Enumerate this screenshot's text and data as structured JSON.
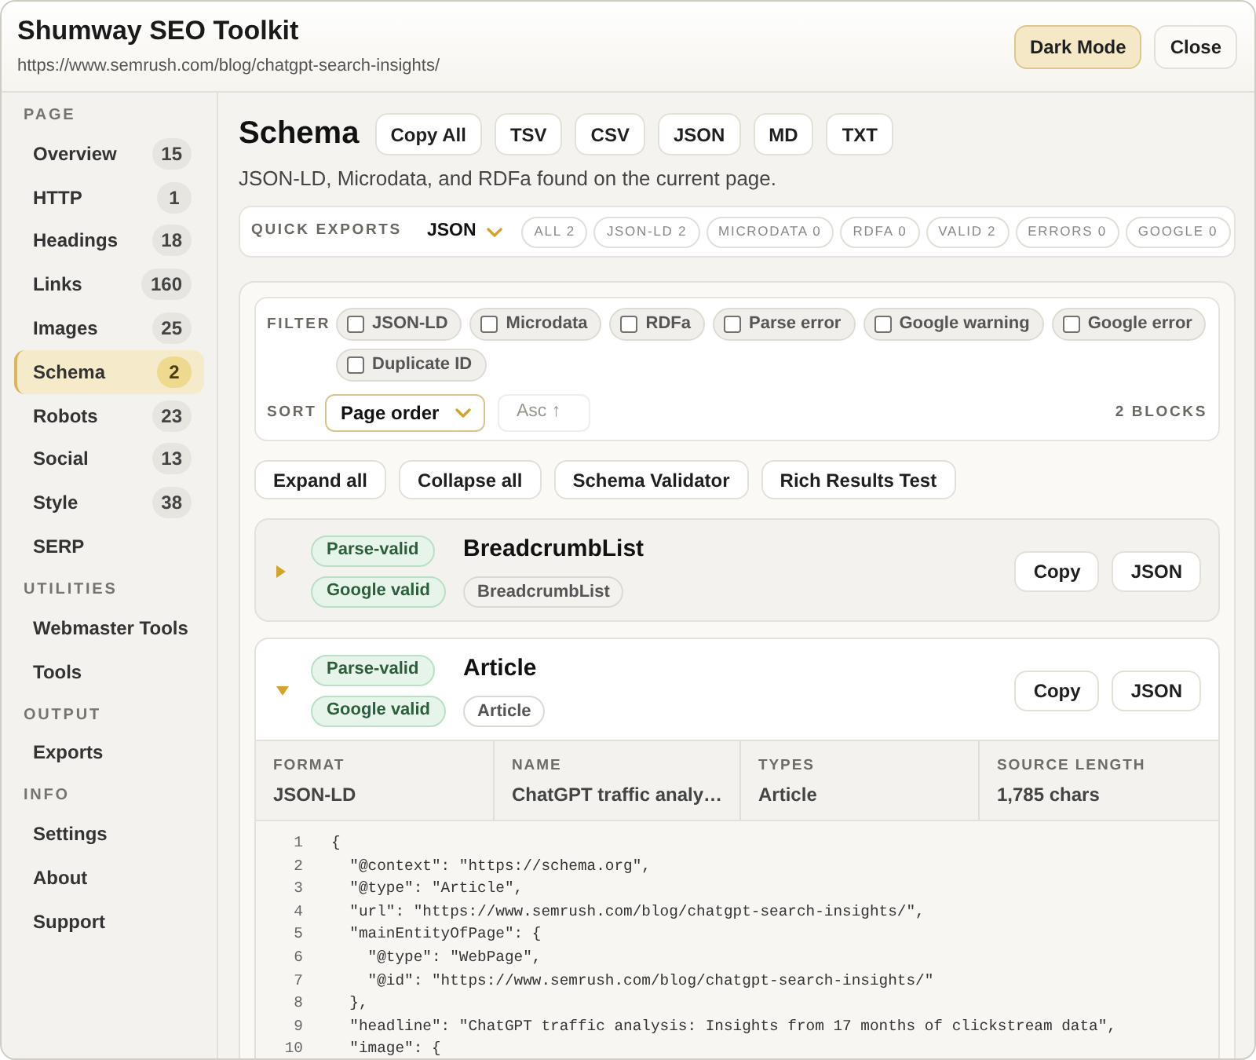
{
  "window": {
    "title": "Shumway SEO Toolkit",
    "url": "https://www.semrush.com/blog/chatgpt-search-insights/"
  },
  "header_buttons": [
    {
      "label": "Dark Mode",
      "kind": "accent"
    },
    {
      "label": "Close",
      "kind": "plain"
    }
  ],
  "sidebar": {
    "sections": [
      {
        "title": "PAGE",
        "items": [
          {
            "label": "Overview",
            "count": "15",
            "selected": false
          },
          {
            "label": "HTTP",
            "count": "1",
            "selected": false
          },
          {
            "label": "Headings",
            "count": "18",
            "selected": false
          },
          {
            "label": "Links",
            "count": "160",
            "selected": false
          },
          {
            "label": "Images",
            "count": "25",
            "selected": false
          },
          {
            "label": "Schema",
            "count": "2",
            "selected": true
          },
          {
            "label": "Robots",
            "count": "23",
            "selected": false
          },
          {
            "label": "Social",
            "count": "13",
            "selected": false
          },
          {
            "label": "Style",
            "count": "38",
            "selected": false
          },
          {
            "label": "SERP",
            "selected": false
          }
        ]
      },
      {
        "title": "UTILITIES",
        "items": [
          {
            "label": "Webmaster Tools",
            "selected": false
          },
          {
            "label": "Tools",
            "selected": false
          }
        ]
      },
      {
        "title": "OUTPUT",
        "items": [
          {
            "label": "Exports",
            "selected": false
          }
        ]
      },
      {
        "title": "INFO",
        "items": [
          {
            "label": "Settings",
            "selected": false
          },
          {
            "label": "About",
            "selected": false
          },
          {
            "label": "Support",
            "selected": false
          }
        ]
      }
    ]
  },
  "page": {
    "title": "Schema",
    "export_buttons": [
      "Copy All",
      "TSV",
      "CSV",
      "JSON",
      "MD",
      "TXT"
    ],
    "description": "JSON-LD, Microdata, and RDFa found on the current page."
  },
  "quick_exports": {
    "label": "QUICK EXPORTS",
    "format": "JSON",
    "stats": [
      "ALL 2",
      "JSON-LD 2",
      "MICRODATA 0",
      "RDFA 0",
      "VALID 2",
      "ERRORS 0",
      "GOOGLE 0"
    ]
  },
  "filter": {
    "label": "FILTER",
    "options": [
      {
        "label": "JSON-LD",
        "checked": false
      },
      {
        "label": "Microdata",
        "checked": false
      },
      {
        "label": "RDFa",
        "checked": false
      },
      {
        "label": "Parse error",
        "checked": false
      },
      {
        "label": "Google warning",
        "checked": false
      },
      {
        "label": "Google error",
        "checked": false
      },
      {
        "label": "Duplicate ID",
        "checked": false
      }
    ]
  },
  "sort": {
    "label": "SORT",
    "value": "Page order",
    "direction": {
      "label": "Asc ↑",
      "disabled": true
    },
    "count": "2 BLOCKS"
  },
  "actions": [
    "Expand all",
    "Collapse all",
    "Schema Validator",
    "Rich Results Test"
  ],
  "blocks": [
    {
      "title": "BreadcrumbList",
      "expanded": false,
      "statuses": [
        "Parse-valid",
        "Google valid"
      ],
      "types": [
        "BreadcrumbList"
      ],
      "buttons": [
        "Copy",
        "JSON"
      ]
    },
    {
      "title": "Article",
      "expanded": true,
      "statuses": [
        "Parse-valid",
        "Google valid"
      ],
      "types": [
        "Article"
      ],
      "buttons": [
        "Copy",
        "JSON"
      ],
      "details": [
        {
          "label": "FORMAT",
          "value": "JSON-LD"
        },
        {
          "label": "NAME",
          "value": "ChatGPT traffic analy…"
        },
        {
          "label": "TYPES",
          "value": "Article"
        },
        {
          "label": "SOURCE LENGTH",
          "value": "1,785 chars"
        }
      ],
      "code": [
        {
          "number": "1",
          "text": "{"
        },
        {
          "number": "2",
          "text": "  \"@context\": \"https://schema.org\","
        },
        {
          "number": "3",
          "text": "  \"@type\": \"Article\","
        },
        {
          "number": "4",
          "text": "  \"url\": \"https://www.semrush.com/blog/chatgpt-search-insights/\","
        },
        {
          "number": "5",
          "text": "  \"mainEntityOfPage\": {"
        },
        {
          "number": "6",
          "text": "    \"@type\": \"WebPage\","
        },
        {
          "number": "7",
          "text": "    \"@id\": \"https://www.semrush.com/blog/chatgpt-search-insights/\""
        },
        {
          "number": "8",
          "text": "  },"
        },
        {
          "number": "9",
          "text": "  \"headline\": \"ChatGPT traffic analysis: Insights from 17 months of clickstream data\","
        },
        {
          "number": "10",
          "text": "  \"image\": {"
        }
      ]
    }
  ]
}
